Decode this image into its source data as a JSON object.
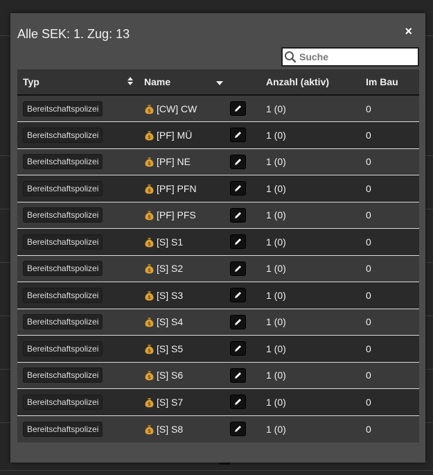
{
  "modal": {
    "title": "Alle SEK: 1. Zug: 13",
    "close_label": "×"
  },
  "search": {
    "placeholder": "Suche",
    "value": ""
  },
  "table": {
    "headers": {
      "type": "Typ",
      "name": "Name",
      "count": "Anzahl (aktiv)",
      "building": "Im Bau"
    },
    "rows": [
      {
        "type": "Bereitschaftspolizei",
        "name": "[CW] CW",
        "count": "1 (0)",
        "building": "0"
      },
      {
        "type": "Bereitschaftspolizei",
        "name": "[PF] MÜ",
        "count": "1 (0)",
        "building": "0"
      },
      {
        "type": "Bereitschaftspolizei",
        "name": "[PF] NE",
        "count": "1 (0)",
        "building": "0"
      },
      {
        "type": "Bereitschaftspolizei",
        "name": "[PF] PFN",
        "count": "1 (0)",
        "building": "0"
      },
      {
        "type": "Bereitschaftspolizei",
        "name": "[PF] PFS",
        "count": "1 (0)",
        "building": "0"
      },
      {
        "type": "Bereitschaftspolizei",
        "name": "[S] S1",
        "count": "1 (0)",
        "building": "0"
      },
      {
        "type": "Bereitschaftspolizei",
        "name": "[S] S2",
        "count": "1 (0)",
        "building": "0"
      },
      {
        "type": "Bereitschaftspolizei",
        "name": "[S] S3",
        "count": "1 (0)",
        "building": "0"
      },
      {
        "type": "Bereitschaftspolizei",
        "name": "[S] S4",
        "count": "1 (0)",
        "building": "0"
      },
      {
        "type": "Bereitschaftspolizei",
        "name": "[S] S5",
        "count": "1 (0)",
        "building": "0"
      },
      {
        "type": "Bereitschaftspolizei",
        "name": "[S] S6",
        "count": "1 (0)",
        "building": "0"
      },
      {
        "type": "Bereitschaftspolizei",
        "name": "[S] S7",
        "count": "1 (0)",
        "building": "0"
      },
      {
        "type": "Bereitschaftspolizei",
        "name": "[S] S8",
        "count": "1 (0)",
        "building": "0"
      }
    ]
  },
  "icons": {
    "search": "search-icon",
    "sort": "sort-icon",
    "sort_desc": "caret-down-icon",
    "vehicle": "money-bag-icon",
    "edit": "pencil-icon",
    "close": "close-icon"
  },
  "colors": {
    "modal_bg": "#4c4c4c",
    "header_bg": "#333333",
    "row_odd": "#3a3a3a",
    "row_even": "#2a2a2a",
    "bag": "#d9a441"
  }
}
